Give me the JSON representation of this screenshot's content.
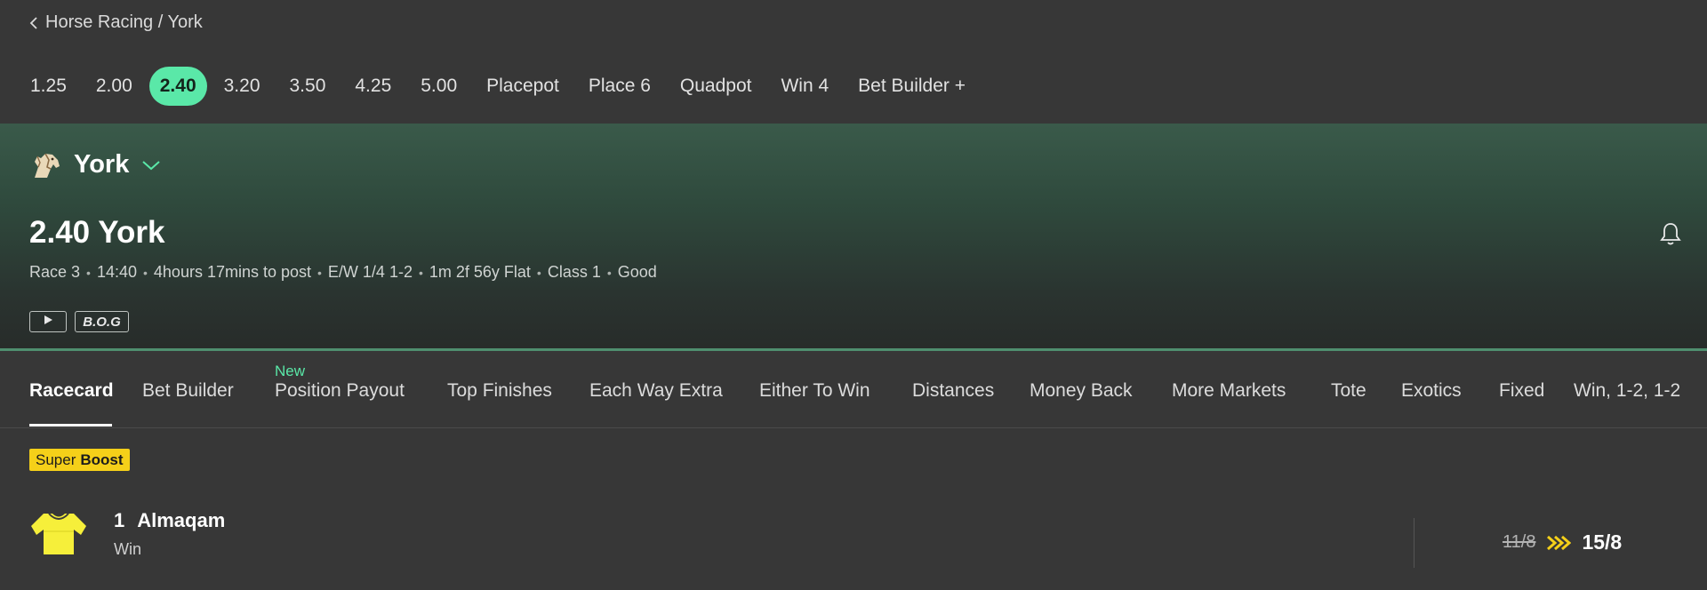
{
  "breadcrumb": {
    "text": "Horse Racing / York"
  },
  "race_nav": {
    "items": [
      "1.25",
      "2.00",
      "2.40",
      "3.20",
      "3.50",
      "4.25",
      "5.00",
      "Placepot",
      "Place 6",
      "Quadpot",
      "Win 4",
      "Bet Builder +"
    ],
    "active": "2.40"
  },
  "venue": {
    "name": "York"
  },
  "race": {
    "title": "2.40 York",
    "meta": [
      "Race 3",
      "14:40",
      "4hours 17mins to post",
      "E/W 1/4 1-2",
      "1m 2f 56y Flat",
      "Class 1",
      "Good"
    ],
    "badges": {
      "bog": "B.O.G"
    }
  },
  "tabs": {
    "items": [
      "Racecard",
      "Bet Builder",
      "Position Payout",
      "Top Finishes",
      "Each Way Extra",
      "Either To Win",
      "Distances",
      "Money Back",
      "More Markets",
      "Tote",
      "Exotics",
      "Fixed",
      "Win, 1-2, 1-2"
    ],
    "active": "Racecard",
    "new_label": "New"
  },
  "boost": {
    "label_prefix": "Super",
    "label_strong": "Boost",
    "runner_number": "1",
    "runner_name": "Almaqam",
    "market": "Win",
    "old_odds": "11/8",
    "new_odds": "15/8"
  },
  "colors": {
    "accent": "#5ae8a8",
    "boost": "#f5d019",
    "background": "#373737"
  }
}
